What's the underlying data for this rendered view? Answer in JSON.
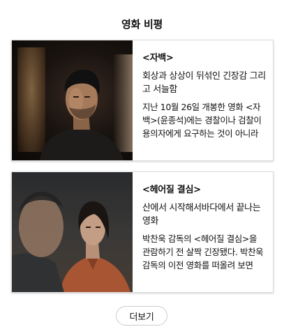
{
  "section": {
    "title": "영화 비평"
  },
  "cards": [
    {
      "title": "<자백>",
      "subtitle": "회상과 상상이 뒤섞인 긴장감 그리고 서늘함",
      "summary": "지난 10월 26일 개봉한 영화 <자백>(윤종석)에는 경찰이나 검찰이 용의자에게 요구하는 것이 아니라"
    },
    {
      "title": "<헤어질 결심>",
      "subtitle": "산에서 시작해서바다에서 끝나는 영화",
      "summary": "박찬욱 감독의 <헤어질 결심>을 관람하기 전 살짝 긴장됐다. 박찬욱 감독의 이전 영화를 떠올려 보면"
    }
  ],
  "more_button": {
    "label": "더보기"
  }
}
